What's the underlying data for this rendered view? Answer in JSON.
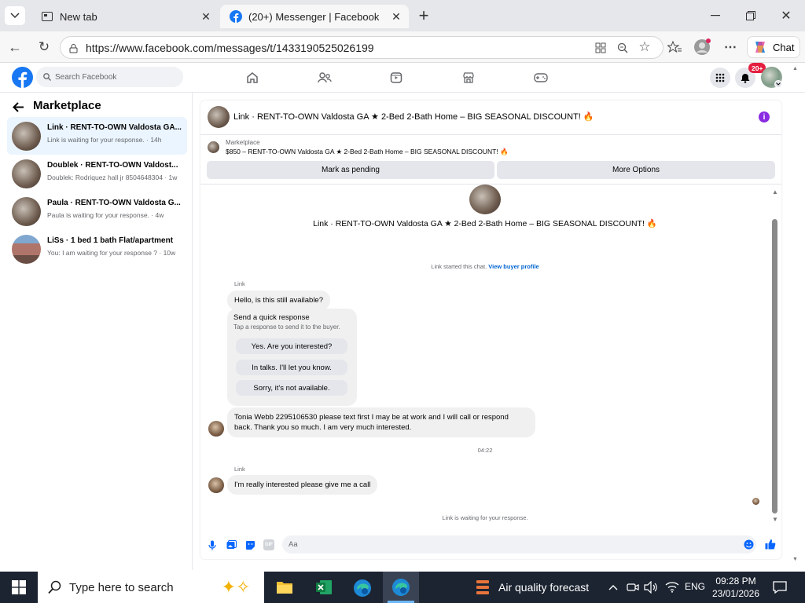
{
  "browser": {
    "tabs": [
      {
        "title": "New tab",
        "active": false
      },
      {
        "title": "(20+) Messenger | Facebook",
        "active": true
      }
    ],
    "url": "https://www.facebook.com/messages/t/1433190525026199",
    "chat_button": "Chat"
  },
  "fb": {
    "search_placeholder": "Search Facebook",
    "notification_badge": "20+",
    "brand_color": "#1877f2"
  },
  "sidebar": {
    "title": "Marketplace",
    "conversations": [
      {
        "title": "Link · RENT-TO-OWN Valdosta GA...",
        "preview": "Link is waiting for your response. · 14h",
        "selected": true
      },
      {
        "title": "Doublek · RENT-TO-OWN Valdost...",
        "preview": "Doublek: Rodriquez hall jr 8504648304 · 1w",
        "selected": false
      },
      {
        "title": "Paula · RENT-TO-OWN Valdosta G...",
        "preview": "Paula is waiting for your response. · 4w",
        "selected": false
      },
      {
        "title": "LiSs · 1 bed 1 bath Flat/apartment",
        "preview": "You: I am waiting for your response ? · 10w",
        "selected": false
      }
    ]
  },
  "chat": {
    "header_title": "Link · RENT-TO-OWN Valdosta GA ★ 2-Bed 2-Bath Home – BIG SEASONAL DISCOUNT! 🔥",
    "listing_label": "Marketplace",
    "listing_text": "$850 – RENT-TO-OWN Valdosta GA ★ 2-Bed 2-Bath Home – BIG SEASONAL DISCOUNT! 🔥",
    "mark_pending": "Mark as pending",
    "more_options": "More Options",
    "intro_title": "Link · RENT-TO-OWN Valdosta GA ★ 2-Bed 2-Bath Home – BIG SEASONAL DISCOUNT! 🔥",
    "started_text": "Link started this chat.",
    "view_buyer": "View buyer profile",
    "sender_name_1": "Link",
    "msg1": "Hello, is this still available?",
    "quick_title": "Send a quick response",
    "quick_sub": "Tap a response to send it to the buyer.",
    "quick_replies": [
      "Yes. Are you interested?",
      "In talks. I'll let you know.",
      "Sorry, it's not available."
    ],
    "msg2": "Tonia Webb 2295106530 please text first I may be at work and I will call or respond back. Thank you so much. I am very much interested.",
    "timestamp": "04:22",
    "sender_name_2": "Link",
    "msg3": "I'm really interested please give me a call",
    "waiting": "Link is waiting for your response.",
    "composer_placeholder": "Aa"
  },
  "taskbar": {
    "search_placeholder": "Type here to search",
    "weather": "Air quality forecast",
    "language": "ENG",
    "time": "09:28 PM",
    "date": "23/01/2026"
  }
}
